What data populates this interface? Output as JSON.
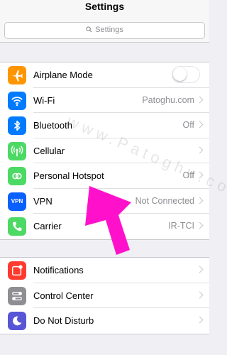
{
  "header": {
    "title": "Settings",
    "search_placeholder": "Settings"
  },
  "group1": [
    {
      "label": "Airplane Mode",
      "value": "",
      "icon": "airplane-icon",
      "color": "#ff9500",
      "toggle": "off"
    },
    {
      "label": "Wi-Fi",
      "value": "Patoghu.com",
      "icon": "wifi-icon",
      "color": "#007aff"
    },
    {
      "label": "Bluetooth",
      "value": "Off",
      "icon": "bluetooth-icon",
      "color": "#007aff"
    },
    {
      "label": "Cellular",
      "value": "",
      "icon": "cellular-icon",
      "color": "#4cd964"
    },
    {
      "label": "Personal Hotspot",
      "value": "Off",
      "icon": "hotspot-icon",
      "color": "#4cd964"
    },
    {
      "label": "VPN",
      "value": "Not Connected",
      "icon": "vpn-icon",
      "icon_text": "VPN",
      "color": "#0a60ff"
    },
    {
      "label": "Carrier",
      "value": "IR-TCI",
      "icon": "phone-icon",
      "color": "#4cd964"
    }
  ],
  "group2": [
    {
      "label": "Notifications",
      "icon": "notifications-icon",
      "color": "#ff3b30"
    },
    {
      "label": "Control Center",
      "icon": "control-center-icon",
      "color": "#8e8e93"
    },
    {
      "label": "Do Not Disturb",
      "icon": "moon-icon",
      "color": "#5856d6"
    }
  ],
  "watermark": "www.Patoghu.com",
  "arrow_color": "#ff11cc"
}
